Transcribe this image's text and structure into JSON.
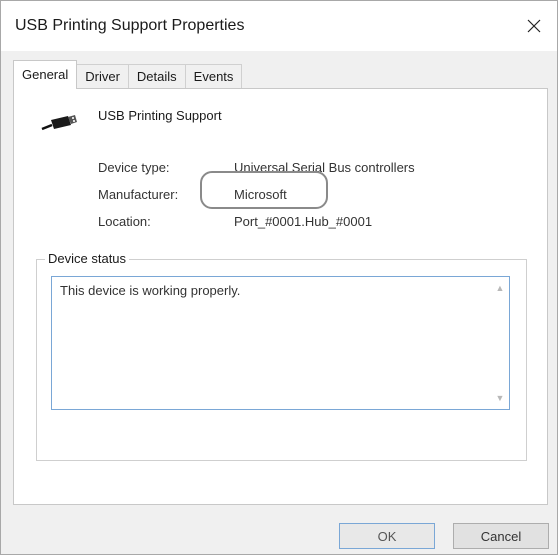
{
  "window": {
    "title": "USB Printing Support Properties"
  },
  "tabs": [
    {
      "label": "General",
      "active": true
    },
    {
      "label": "Driver",
      "active": false
    },
    {
      "label": "Details",
      "active": false
    },
    {
      "label": "Events",
      "active": false
    }
  ],
  "device": {
    "name": "USB Printing Support",
    "icon": "usb-plug-icon"
  },
  "properties": {
    "type_label": "Device type:",
    "type_value": "Universal Serial Bus controllers",
    "manufacturer_label": "Manufacturer:",
    "manufacturer_value": "Microsoft",
    "location_label": "Location:",
    "location_value": "Port_#0001.Hub_#0001"
  },
  "status": {
    "legend": "Device status",
    "text": "This device is working properly."
  },
  "buttons": {
    "ok": "OK",
    "cancel": "Cancel"
  },
  "colors": {
    "focus_border": "#7aa7d6",
    "highlight_ring": "#8a8a8a"
  }
}
